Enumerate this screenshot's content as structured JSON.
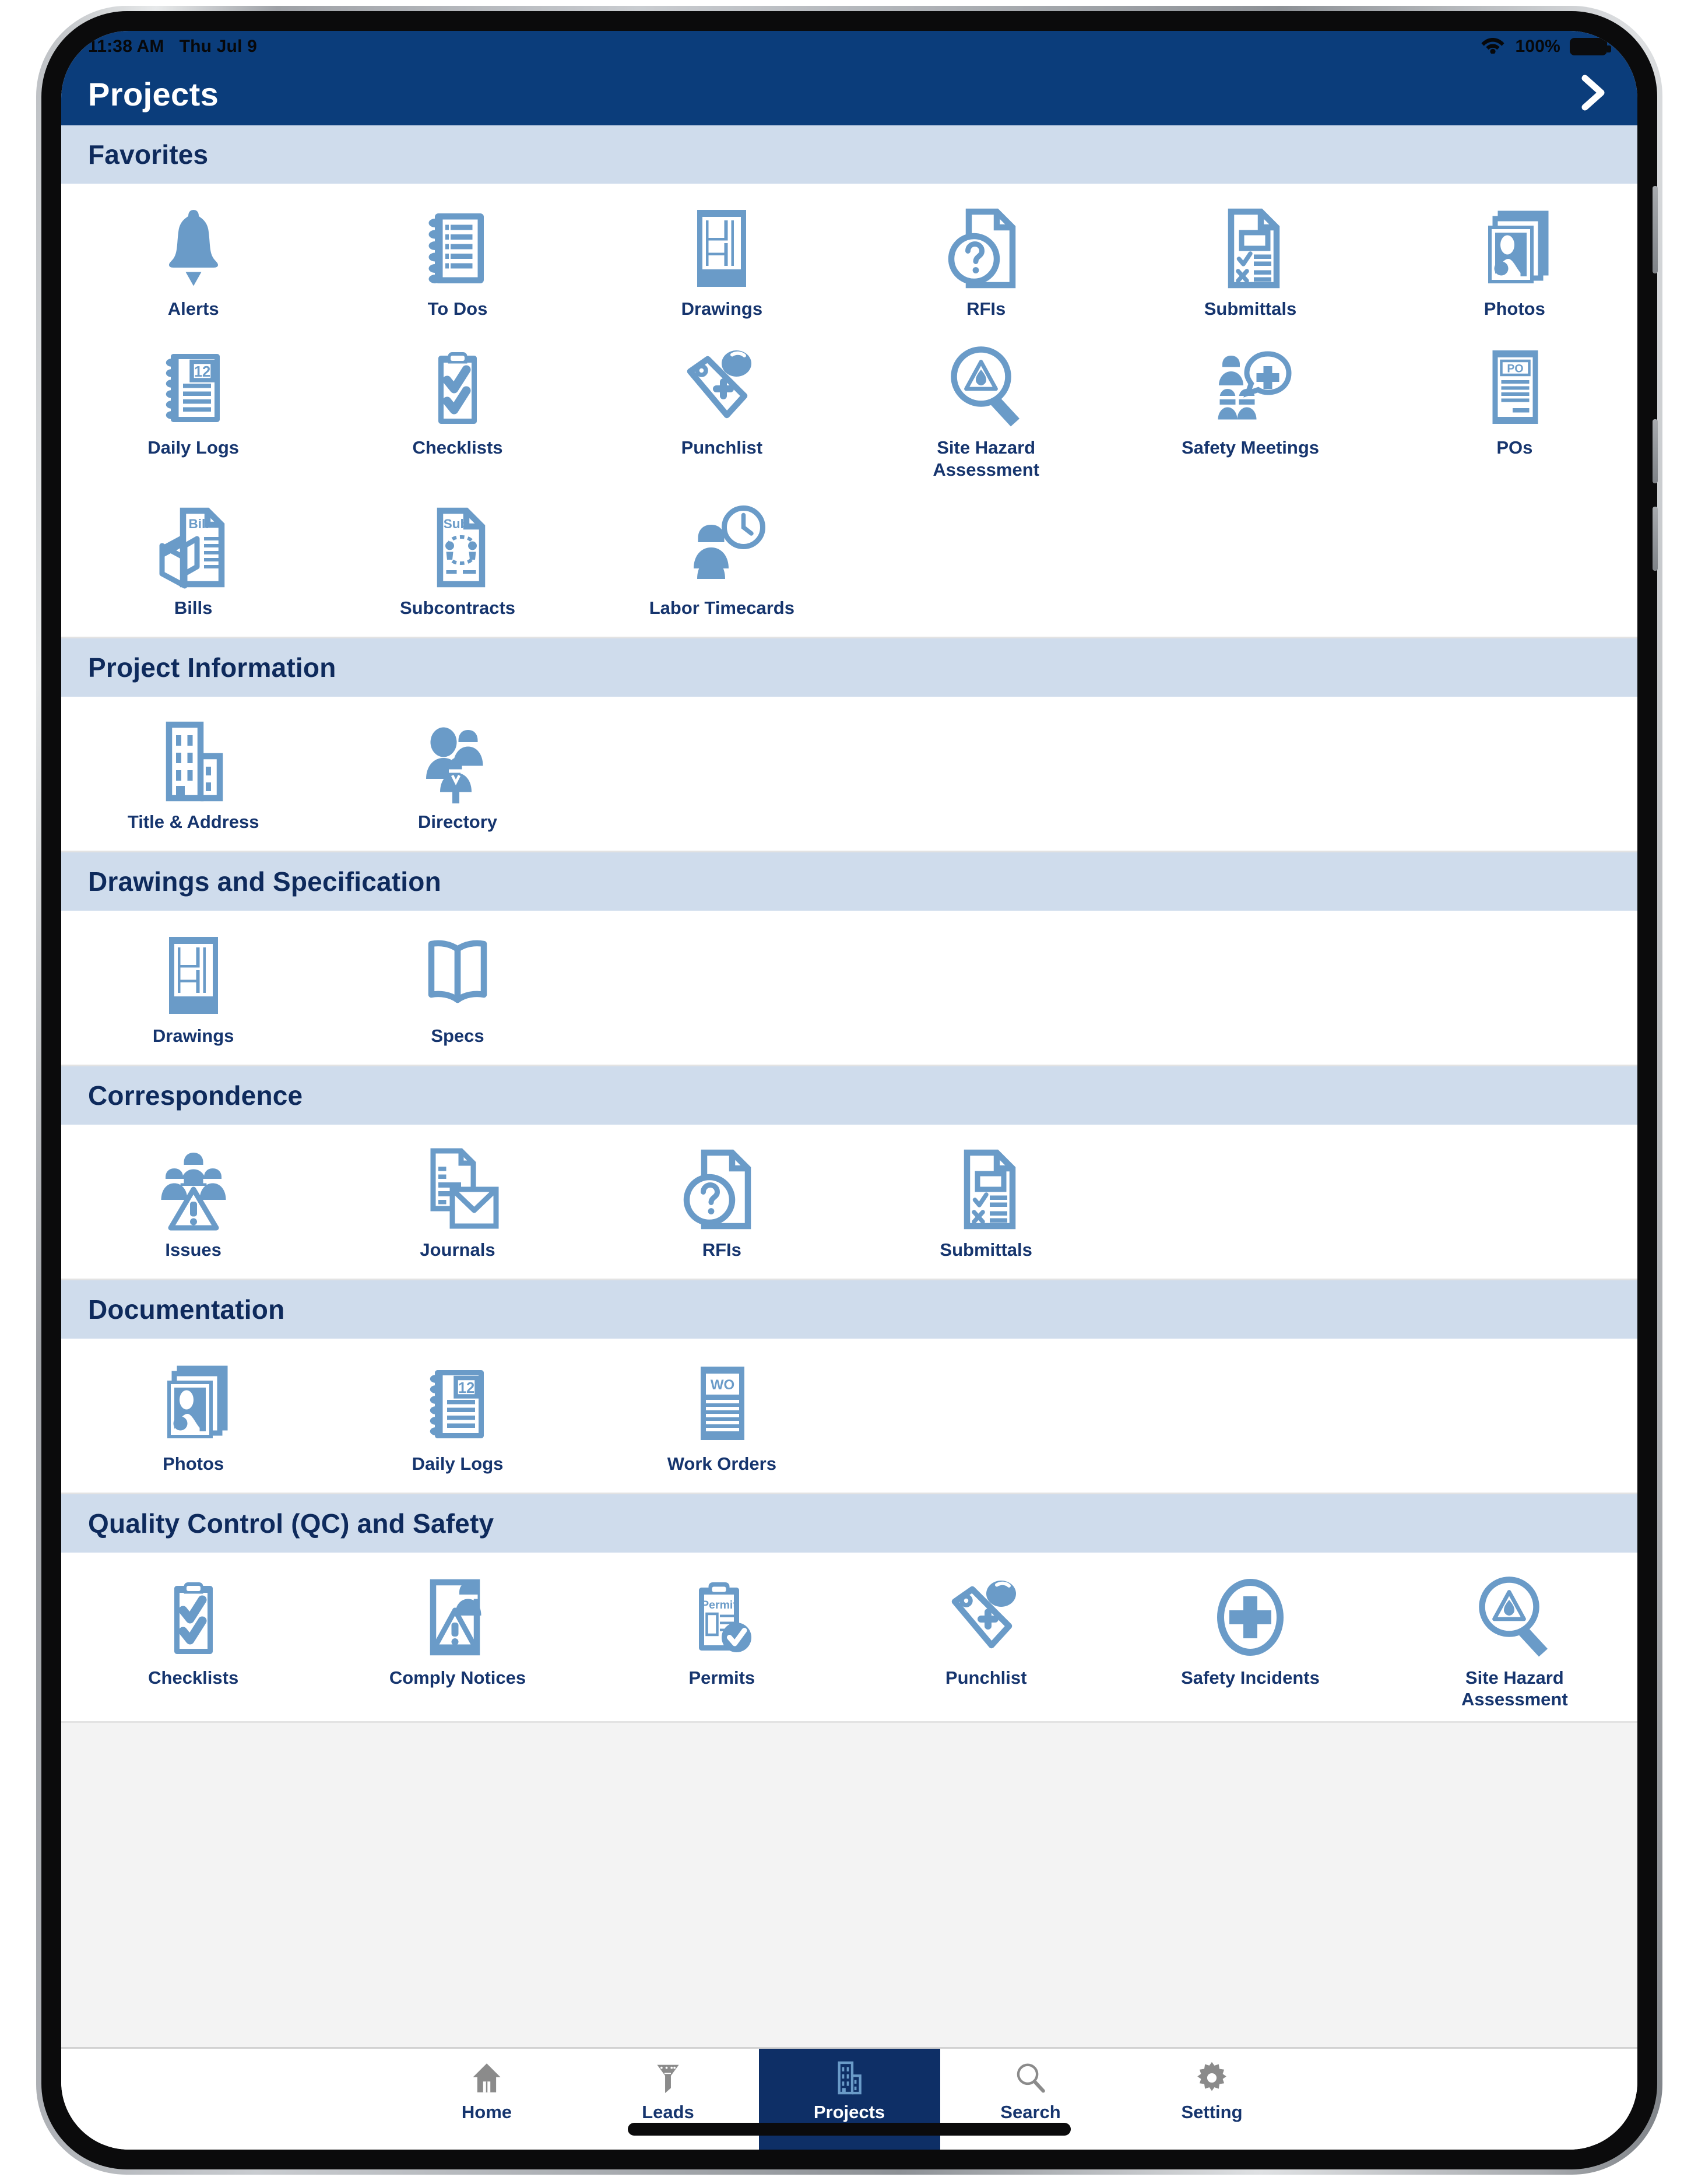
{
  "status_bar": {
    "time": "11:38 AM",
    "date": "Thu Jul 9",
    "battery_percent": "100%",
    "wifi_icon": "wifi-icon",
    "battery_icon": "battery-full-icon"
  },
  "nav": {
    "title": "Projects",
    "forward_icon": "chevron-right-icon"
  },
  "sections": [
    {
      "title": "Favorites",
      "columns": 6,
      "tiles": [
        {
          "label": "Alerts",
          "icon": "bell-icon"
        },
        {
          "label": "To Dos",
          "icon": "notepad-list-icon"
        },
        {
          "label": "Drawings",
          "icon": "blueprint-icon"
        },
        {
          "label": "RFIs",
          "icon": "document-question-icon"
        },
        {
          "label": "Submittals",
          "icon": "document-checklist-icon"
        },
        {
          "label": "Photos",
          "icon": "photo-stack-icon"
        },
        {
          "label": "Daily Logs",
          "icon": "notepad-calendar-icon"
        },
        {
          "label": "Checklists",
          "icon": "clipboard-check-icon"
        },
        {
          "label": "Punchlist",
          "icon": "tag-plus-icon"
        },
        {
          "label": "Site Hazard Assessment",
          "icon": "magnifier-hazard-icon"
        },
        {
          "label": "Safety Meetings",
          "icon": "workers-medical-icon"
        },
        {
          "label": "POs",
          "icon": "purchase-order-icon"
        },
        {
          "label": "Bills",
          "icon": "bill-document-icon"
        },
        {
          "label": "Subcontracts",
          "icon": "subcontract-document-icon"
        },
        {
          "label": "Labor Timecards",
          "icon": "worker-clock-icon"
        }
      ]
    },
    {
      "title": "Project Information",
      "columns": 6,
      "tiles": [
        {
          "label": "Title & Address",
          "icon": "building-icon"
        },
        {
          "label": "Directory",
          "icon": "people-group-icon"
        }
      ]
    },
    {
      "title": "Drawings and Specification",
      "columns": 6,
      "tiles": [
        {
          "label": "Drawings",
          "icon": "blueprint-icon"
        },
        {
          "label": "Specs",
          "icon": "open-book-icon"
        }
      ]
    },
    {
      "title": "Correspondence",
      "columns": 6,
      "tiles": [
        {
          "label": "Issues",
          "icon": "workers-warning-icon"
        },
        {
          "label": "Journals",
          "icon": "document-envelope-icon"
        },
        {
          "label": "RFIs",
          "icon": "document-question-icon"
        },
        {
          "label": "Submittals",
          "icon": "document-checklist-icon"
        }
      ]
    },
    {
      "title": "Documentation",
      "columns": 6,
      "tiles": [
        {
          "label": "Photos",
          "icon": "photo-stack-icon"
        },
        {
          "label": "Daily Logs",
          "icon": "notepad-calendar-icon"
        },
        {
          "label": "Work Orders",
          "icon": "work-order-icon"
        }
      ]
    },
    {
      "title": "Quality Control (QC) and Safety",
      "columns": 6,
      "tiles": [
        {
          "label": "Checklists",
          "icon": "clipboard-check-icon"
        },
        {
          "label": "Comply Notices",
          "icon": "worker-warning-notice-icon"
        },
        {
          "label": "Permits",
          "icon": "permit-clipboard-icon"
        },
        {
          "label": "Punchlist",
          "icon": "tag-plus-icon"
        },
        {
          "label": "Safety Incidents",
          "icon": "medical-cross-icon"
        },
        {
          "label": "Site Hazard Assessment",
          "icon": "magnifier-hazard-icon"
        }
      ]
    }
  ],
  "tab_bar": {
    "items": [
      {
        "label": "Home",
        "icon": "home-icon",
        "active": false
      },
      {
        "label": "Leads",
        "icon": "funnel-icon",
        "active": false
      },
      {
        "label": "Projects",
        "icon": "building-icon",
        "active": true
      },
      {
        "label": "Search",
        "icon": "search-icon",
        "active": false
      },
      {
        "label": "Setting",
        "icon": "gear-icon",
        "active": false
      }
    ]
  },
  "colors": {
    "header_blue": "#0b3d7b",
    "section_band": "#cfdcec",
    "icon_blue": "#6a9bc8",
    "label_navy": "#16356e",
    "tab_active_bg": "#0e2f66"
  }
}
